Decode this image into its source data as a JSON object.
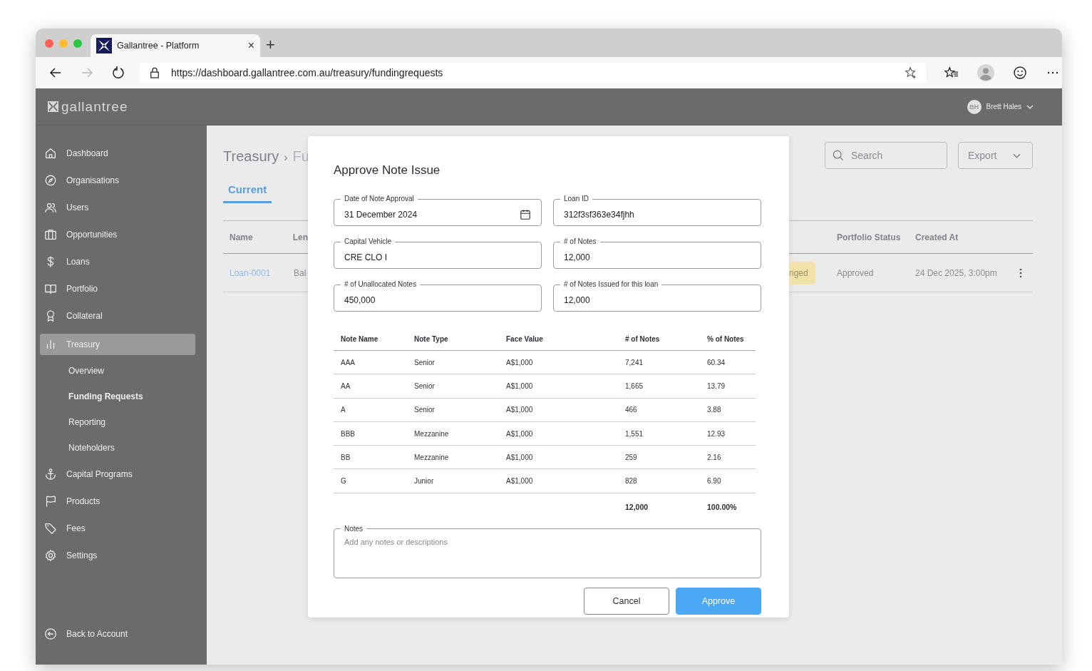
{
  "browser": {
    "tab_title": "Gallantree - Platform",
    "tab_close": "×",
    "new_tab": "+",
    "url": "https://dashboard.gallantree.com.au/treasury/fundingrequests"
  },
  "header": {
    "logo": "gallantree",
    "user_initials": "BH",
    "user_name": "Brett Hales"
  },
  "sidebar": {
    "items": [
      {
        "label": "Dashboard",
        "selected": false
      },
      {
        "label": "Organisations",
        "selected": false
      },
      {
        "label": "Users",
        "selected": false
      },
      {
        "label": "Opportunities",
        "selected": false
      },
      {
        "label": "Loans",
        "selected": false
      },
      {
        "label": "Portfolio",
        "selected": false
      },
      {
        "label": "Collateral",
        "selected": false
      },
      {
        "label": "Treasury",
        "selected": true,
        "expanded": true,
        "children": [
          {
            "label": "Overview",
            "selected": false
          },
          {
            "label": "Funding Requests",
            "selected": true
          },
          {
            "label": "Reporting",
            "selected": false
          },
          {
            "label": "Noteholders",
            "selected": false
          }
        ]
      },
      {
        "label": "Capital Programs",
        "selected": false
      },
      {
        "label": "Products",
        "selected": false
      },
      {
        "label": "Fees",
        "selected": false
      },
      {
        "label": "Settings",
        "selected": false
      }
    ],
    "footer": "Back to Account"
  },
  "page": {
    "breadcrumb": [
      "Treasury",
      "Fu"
    ],
    "breadcrumb_separator": "›",
    "tabs": [
      {
        "label": "Current",
        "selected": true
      }
    ],
    "search": {
      "placeholder": "Search"
    },
    "export": "Export",
    "table": {
      "columns_left": [
        "Name",
        "Len"
      ],
      "columns_right": [
        "Portfolio Status",
        "Created At"
      ],
      "rows": [
        {
          "name": "Loan-0001",
          "column_2": "Bal",
          "badge": "nged",
          "portfolio_status": "Approved",
          "created_at": "24 Dec 2025, 3:00pm"
        }
      ]
    }
  },
  "modal": {
    "title": "Approve Note Issue",
    "fields": [
      {
        "label": "Date of Note Approval",
        "value": "31 December 2024",
        "kind": "date"
      },
      {
        "label": "Loan ID",
        "value": "312f3sf363e34fjhh",
        "kind": "text"
      },
      {
        "label": "Capital Vehicle",
        "value": "CRE CLO I",
        "kind": "text"
      },
      {
        "label": "# of Notes",
        "value": "12,000",
        "kind": "text"
      },
      {
        "label": "# of Unallocated Notes",
        "value": "450,000",
        "kind": "text"
      },
      {
        "label": "# of Notes Issued for this loan",
        "value": "12,000",
        "kind": "text"
      }
    ],
    "table": {
      "columns": [
        "Note Name",
        "Note Type",
        "Face Value",
        "# of Notes",
        "% of Notes"
      ],
      "rows": [
        [
          "AAA",
          "Senior",
          "A$1,000",
          "7,241",
          "60.34"
        ],
        [
          "AA",
          "Senior",
          "A$1,000",
          "1,665",
          "13.79"
        ],
        [
          "A",
          "Senior",
          "A$1,000",
          "466",
          "3.88"
        ],
        [
          "BBB",
          "Mezzanine",
          "A$1,000",
          "1,551",
          "12.93"
        ],
        [
          "BB",
          "Mezzanine",
          "A$1,000",
          "259",
          "2.16"
        ],
        [
          "G",
          "Junior",
          "A$1,000",
          "828",
          "6.90"
        ]
      ],
      "totals": [
        "12,000",
        "100.00%"
      ]
    },
    "notes": {
      "label": "Notes",
      "placeholder": "Add any notes or descriptions"
    },
    "buttons": [
      {
        "label": "Cancel",
        "kind": "secondary"
      },
      {
        "label": "Approve",
        "kind": "primary"
      }
    ]
  }
}
